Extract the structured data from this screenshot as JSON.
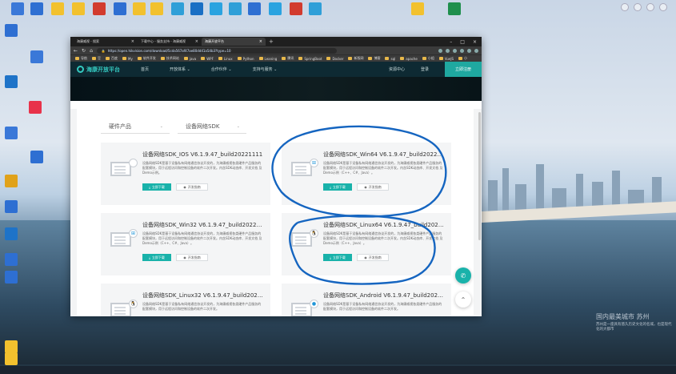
{
  "desktop": {
    "top_icons": [
      {
        "label": "",
        "color": "#3a78d8"
      },
      {
        "label": "",
        "color": "#2e6fd2"
      },
      {
        "label": "",
        "color": "#f2c12e"
      },
      {
        "label": "",
        "color": "#f2c12e"
      },
      {
        "label": "",
        "color": "#d23b2e"
      },
      {
        "label": "",
        "color": "#2e6fd2"
      },
      {
        "label": "",
        "color": "#f2c12e"
      },
      {
        "label": "",
        "color": "#f2c12e"
      },
      {
        "label": "",
        "color": "#2f9fd8"
      },
      {
        "label": "",
        "color": "#1a6fc4"
      },
      {
        "label": "",
        "color": "#2aa3e0"
      },
      {
        "label": "",
        "color": "#2f9fd8"
      },
      {
        "label": "",
        "color": "#2e6fd2"
      },
      {
        "label": "",
        "color": "#2aa3e0"
      },
      {
        "label": "",
        "color": "#d23b2e"
      },
      {
        "label": "",
        "color": "#2f9fd8"
      },
      {
        "label": "",
        "color": "#f2c12e"
      },
      {
        "label": "",
        "color": "#1f8f4d"
      }
    ],
    "left_icons": [
      {
        "label": "",
        "color": "#2e6fd2"
      },
      {
        "label": "",
        "color": "#3a78d8"
      },
      {
        "label": "",
        "color": "#1e73c8"
      },
      {
        "label": "",
        "color": "#e8324a"
      },
      {
        "label": "",
        "color": "#3a78d8"
      },
      {
        "label": "",
        "color": "#2e6fd2"
      },
      {
        "label": "",
        "color": "#e0a21a"
      },
      {
        "label": "",
        "color": "#2e6fd2"
      },
      {
        "label": "",
        "color": "#1e73c8"
      },
      {
        "label": "",
        "color": "#2e6fd2"
      },
      {
        "label": "",
        "color": "#2e6fd2"
      },
      {
        "label": "",
        "color": "#f2c12e"
      },
      {
        "label": "",
        "color": "#f2c12e"
      }
    ],
    "watermark": {
      "title": "国内最美城市 苏州",
      "subtitle": "苏州是一座具有悠久历史文化的名城，也是现代化的大都市"
    }
  },
  "browser": {
    "tabs": [
      {
        "label": "海康威视 - 搜索"
      },
      {
        "label": "下载中心 - 服务支持 - 海康威视"
      },
      {
        "label": "海康开放平台"
      }
    ],
    "url": "https://open.hikvision.com/download/5cda567af47ae80dd41a54b3?type=10",
    "bookmarks": [
      "导航",
      "豆",
      "百度",
      "My",
      "软件开发",
      "技术网站",
      "java",
      "WPF",
      "Linux",
      "Python",
      "Leaning",
      "腾讯",
      "SpringBoot",
      "Docker",
      "新版网",
      "博客",
      "sql",
      "apache",
      "小组",
      "VueJS",
      "小"
    ]
  },
  "site": {
    "logo": "海康开放平台",
    "nav": [
      "首页",
      "开放体系 ⌄",
      "合作伙伴 ⌄",
      "支持与服务 ⌄"
    ],
    "nav_right": [
      "资源中心",
      "登录"
    ],
    "register": "立即注册",
    "filters": [
      {
        "label": "硬件产品"
      },
      {
        "label": "设备网络SDK"
      }
    ],
    "download_label": "立即下载",
    "guide_label": "开发指南",
    "cards": [
      {
        "title": "设备网络SDK_IOS V6.1.9.47_build20221111",
        "desc": "设备网络SDK是基于设备私有网络通信协议开发的，为海康威视各类硬件产品服务的配套模块，用于远程访问和控制设备的软件二次开发。内含SDK动态库、开发文档 及Demo示例。",
        "os": "iOS"
      },
      {
        "title": "设备网络SDK_Win64 V6.1.9.47_build202211...",
        "desc": "设备网络SDK是基于设备私有网络通信协议开发的，为海康威视各类硬件产品服务的配套模块，用于远程访问和控制设备的软件二次开发。内含SDK动态库、开发文档 及Demo示例（C++、C#、Java）。",
        "os": "Windows"
      },
      {
        "title": "设备网络SDK_Win32 V6.1.9.47_build202211...",
        "desc": "设备网络SDK是基于设备私有网络通信协议开发的，为海康威视各类硬件产品服务的配套模块，用于远程访问和控制设备的软件二次开发。内含SDK动态库、开发文档 及Demo示例（C++、C#、Java）。",
        "os": "Windows"
      },
      {
        "title": "设备网络SDK_Linux64 V6.1.9.47_build2021...",
        "desc": "设备网络SDK是基于设备私有网络通信协议开发的，为海康威视各类硬件产品服务的配套模块，用于远程访问和控制设备的软件二次开发。内含SDK动态库、开发文档 及Demo示例（C++、Java）。",
        "os": "Linux"
      },
      {
        "title": "设备网络SDK_Linux32 V6.1.9.47_build20221...",
        "desc": "设备网络SDK是基于设备私有网络通信协议开发的，为海康威视各类硬件产品服务的配套模块，用于远程访问和控制设备的软件二次开发。",
        "os": "Linux"
      },
      {
        "title": "设备网络SDK_Android V6.1.9.47_build2022...",
        "desc": "设备网络SDK是基于设备私有网络通信协议开发的，为海康威视各类硬件产品服务的配套模块，用于远程访问和控制设备的软件二次开发。",
        "os": "Android"
      }
    ]
  },
  "colors": {
    "accent": "#19b2aa",
    "annotation": "#1565c0"
  }
}
